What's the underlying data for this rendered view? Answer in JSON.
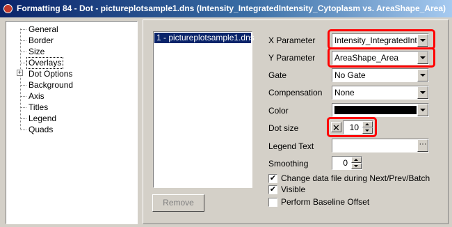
{
  "window": {
    "title": "Formatting 84 - Dot - pictureplotsample1.dns (Intensity_IntegratedIntensity_Cytoplasm vs. AreaShape_Area)"
  },
  "tree": {
    "items": [
      "General",
      "Border",
      "Size",
      "Overlays",
      "Dot Options",
      "Background",
      "Axis",
      "Titles",
      "Legend",
      "Quads"
    ],
    "selected": "Overlays",
    "expander": "+"
  },
  "files": {
    "items": [
      "1 - pictureplotsample1.dns"
    ]
  },
  "buttons": {
    "remove": "Remove"
  },
  "form": {
    "x_parameter": {
      "label": "X Parameter",
      "value": "Intensity_IntegratedIntensity_Cytoplasm"
    },
    "y_parameter": {
      "label": "Y Parameter",
      "value": "AreaShape_Area"
    },
    "gate": {
      "label": "Gate",
      "value": "No Gate"
    },
    "compensation": {
      "label": "Compensation",
      "value": "None"
    },
    "color": {
      "label": "Color",
      "value": "#000000"
    },
    "dot_size": {
      "label": "Dot size",
      "value": "10",
      "x_symbol": "✕"
    },
    "legend_text": {
      "label": "Legend Text",
      "value": "",
      "browse": "···"
    },
    "smoothing": {
      "label": "Smoothing",
      "value": "0"
    },
    "checks": [
      {
        "label": "Change data file during Next/Prev/Batch",
        "checked": true
      },
      {
        "label": "Visible",
        "checked": true
      },
      {
        "label": "Perform Baseline Offset",
        "checked": false
      }
    ]
  },
  "highlight_color": "#ff0000"
}
